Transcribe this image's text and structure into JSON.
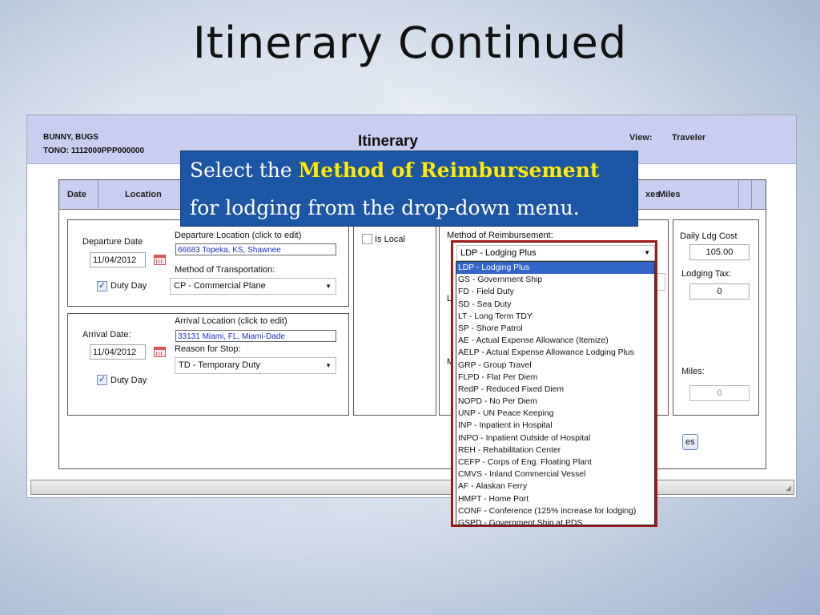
{
  "slide": {
    "title": "Itinerary Continued"
  },
  "app": {
    "user_name": "BUNNY, BUGS",
    "tono": "TONO: 1112000PPP000000",
    "title": "Itinerary",
    "view_label": "View:",
    "view_value": "Traveler"
  },
  "grid": {
    "headers": {
      "date": "Date",
      "location": "Location",
      "taxes_partial": "xes",
      "miles": "Miles"
    }
  },
  "departure": {
    "date_label": "Departure Date",
    "date_value": "11/04/2012",
    "duty_day": "Duty Day",
    "location_label": "Departure Location (click to edit)",
    "location_value": "66683 Topeka, KS, Shawnee",
    "transport_label": "Method of Transportation:",
    "transport_value": "CP - Commercial Plane"
  },
  "arrival": {
    "date_label": "Arrival Date:",
    "date_value": "11/04/2012",
    "duty_day": "Duty Day",
    "location_label": "Arrival Location (click to edit)",
    "location_value": "33131 Miami, FL, Miami-Dade",
    "reason_label": "Reason for Stop:",
    "reason_value": "TD - Temporary Duty"
  },
  "is_local": "Is Local",
  "reimbursement": {
    "label": "Method of Reimbursement:",
    "partial_l": "L",
    "partial_m": "M",
    "selected": "LDP - Lodging Plus",
    "options": [
      "LDP - Lodging Plus",
      "GS - Government Ship",
      "FD - Field Duty",
      "SD - Sea Duty",
      "LT - Long Term TDY",
      "SP - Shore Patrol",
      "AE - Actual Expense Allowance (Itemize)",
      "AELP - Actual Expense Allowance Lodging Plus",
      "GRP - Group Travel",
      "FLPD - Flat Per Diem",
      "RedP - Reduced Fixed Diem",
      "NOPD - No Per Diem",
      "UNP - UN Peace Keeping",
      "INP - Inpatient in Hospital",
      "INPO - Inpatient Outside of Hospital",
      "REH - Rehabilitation Center",
      "CEFP - Corps of Eng. Floating Plant",
      "CMVS - Inland Commercial Vessel",
      "AF - Alaskan Ferry",
      "HMPT - Home Port",
      "CONF - Conference (125% increase for lodging)",
      "GSPD - Government Ship at PDS"
    ]
  },
  "costs": {
    "daily_ldg_label": "Daily Ldg Cost",
    "daily_ldg_value": "105.00",
    "lodging_tax_label": "Lodging Tax:",
    "lodging_tax_value": "0",
    "miles_label": "Miles:",
    "miles_value": "0"
  },
  "partial_button": "es",
  "callout": {
    "pre": "Select the ",
    "highlight": "Method of Reimbursement",
    "line2": "for lodging from the drop-down menu."
  },
  "colors": {
    "callout_bg": "#1d56a4",
    "highlight": "#ffea00",
    "header_bg": "#c9cdf0",
    "selected_option": "#3165c8",
    "outline": "#a01818"
  }
}
